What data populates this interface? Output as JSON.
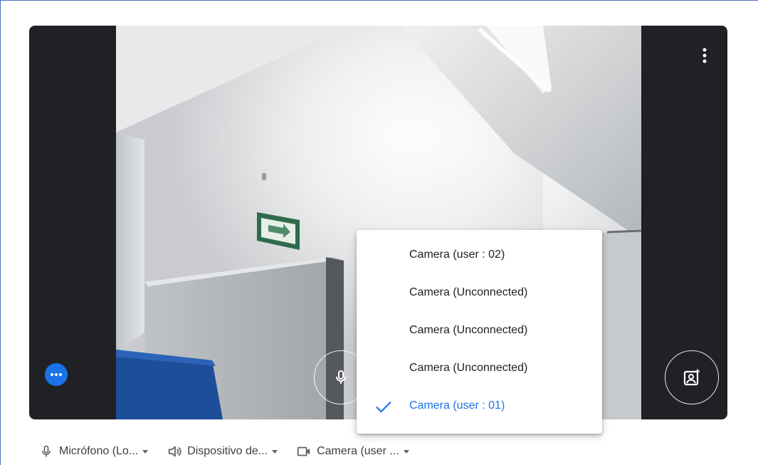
{
  "camera_menu": {
    "items": [
      {
        "label": "Camera (user : 02)",
        "selected": false
      },
      {
        "label": "Camera (Unconnected)",
        "selected": false
      },
      {
        "label": "Camera (Unconnected)",
        "selected": false
      },
      {
        "label": "Camera (Unconnected)",
        "selected": false
      },
      {
        "label": "Camera (user : 01)",
        "selected": true
      }
    ]
  },
  "devices": {
    "microphone": {
      "label": "Micrófono (Lo...",
      "icon": "microphone-icon"
    },
    "speaker": {
      "label": "Dispositivo de...",
      "icon": "speaker-icon"
    },
    "camera": {
      "label": "Camera (user ...",
      "icon": "video-camera-icon"
    }
  },
  "colors": {
    "accent": "#1a73e8",
    "preview_bg": "#202124",
    "text": "#3c4043"
  }
}
